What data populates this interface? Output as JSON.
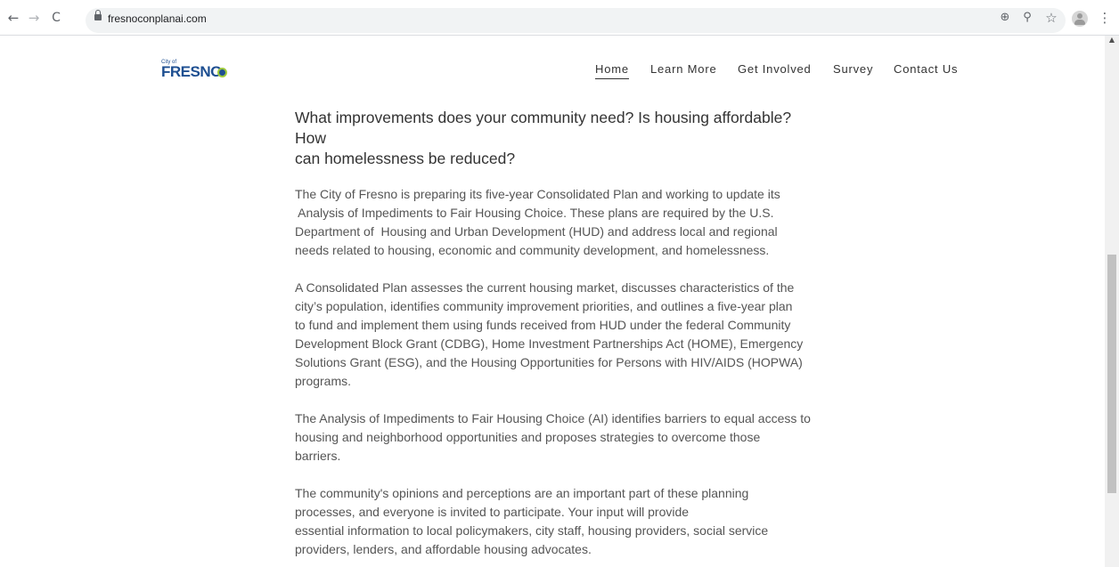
{
  "browser": {
    "url": "fresnoconplanai.com",
    "back_icon": "←",
    "forward_icon": "→",
    "reload_icon": "C",
    "install_icon": "⊕",
    "zoom_icon": "⚲",
    "star_icon": "☆",
    "menu_icon": "⋮"
  },
  "logo": {
    "small_text": "City of",
    "word": "FRESNO"
  },
  "nav": {
    "items": [
      "Home",
      "Learn More",
      "Get Involved",
      "Survey",
      "Contact Us"
    ]
  },
  "content": {
    "headline_line1": "What improvements does your community need? Is housing affordable? How",
    "headline_line2": "can homelessness be reduced?",
    "p1": [
      "The City of Fresno is preparing its five-year Consolidated Plan and working to update its",
      " Analysis of Impediments to Fair Housing Choice. These plans are required by the U.S.",
      "Department of  Housing and Urban Development (HUD) and address local and regional",
      "needs related to housing, economic and community development, and homelessness."
    ],
    "p2": [
      "A Consolidated Plan assesses the current housing market, discusses characteristics of the",
      "city’s population, identifies community improvement priorities, and outlines a five-year plan",
      "to fund and implement them using funds received from HUD under the federal Community",
      "Development Block Grant (CDBG), Home Investment Partnerships Act (HOME), Emergency",
      "Solutions Grant (ESG), and the Housing Opportunities for Persons with HIV/AIDS (HOPWA)",
      "programs."
    ],
    "p3": [
      "The Analysis of Impediments to Fair Housing Choice (AI) identifies barriers to equal access to",
      "housing and neighborhood opportunities and proposes strategies to overcome those",
      "barriers."
    ],
    "p4": [
      "The community's opinions and perceptions are an important part of these planning",
      "processes, and everyone is invited to participate. Your input will provide",
      "essential information to local policymakers, city staff, housing providers, social service",
      "providers, lenders, and affordable housing advocates."
    ]
  },
  "colors": {
    "brand_blue": "#1e4f91",
    "brand_green": "#9ecb3b",
    "heading_text": "#333333",
    "body_text": "#555555"
  }
}
